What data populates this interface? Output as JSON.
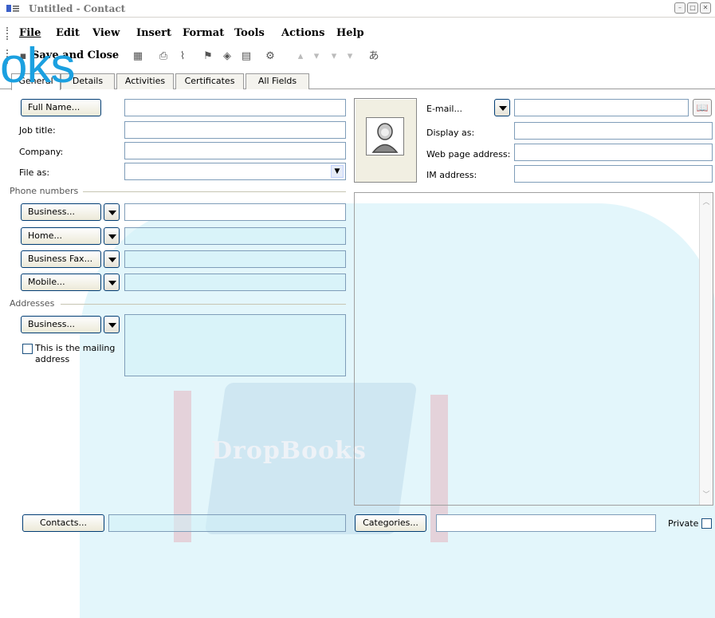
{
  "window": {
    "title": "Untitled - Contact"
  },
  "menu": [
    "File",
    "Edit",
    "View",
    "Insert",
    "Format",
    "Tools",
    "Actions",
    "Help"
  ],
  "toolbar": {
    "save_close": "Save and Close"
  },
  "tabs": [
    "General",
    "Details",
    "Activities",
    "Certificates",
    "All Fields"
  ],
  "left": {
    "full_name_btn": "Full Name...",
    "job_title": "Job title:",
    "company": "Company:",
    "file_as": "File as:",
    "phone_section": "Phone numbers",
    "phones": [
      "Business...",
      "Home...",
      "Business Fax...",
      "Mobile..."
    ],
    "address_section": "Addresses",
    "address_type": "Business...",
    "mailing_label": "This is the mailing address"
  },
  "right": {
    "email_btn": "E-mail...",
    "display_as": "Display as:",
    "web_page": "Web page address:",
    "im_address": "IM address:"
  },
  "bottom": {
    "contacts_btn": "Contacts...",
    "categories_btn": "Categories...",
    "private_label": "Private"
  },
  "watermark": {
    "text": "DropBooks",
    "top_text": "oks"
  }
}
